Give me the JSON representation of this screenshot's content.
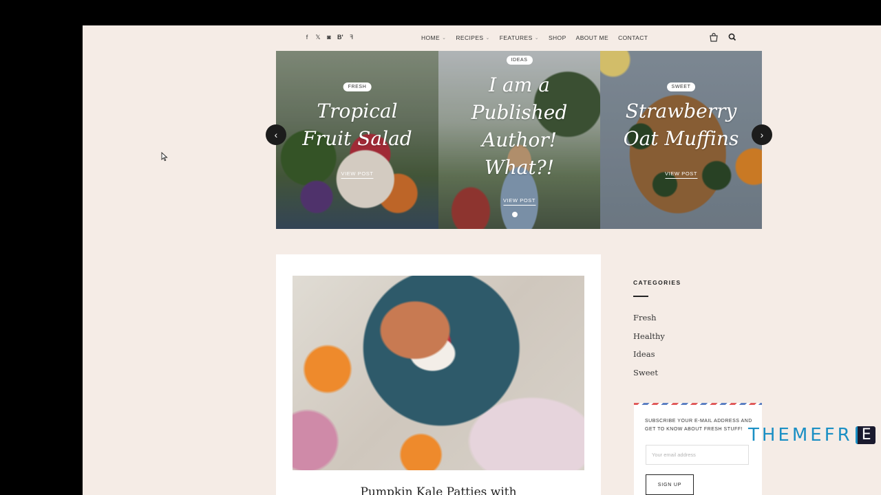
{
  "header": {
    "social_icons": [
      "facebook-icon",
      "twitter-icon",
      "instagram-icon",
      "bloglovin-icon",
      "foursquare-icon"
    ],
    "social_glyphs": [
      "f",
      "𝕏",
      "◙",
      "B'",
      "ꟻ"
    ],
    "nav": [
      {
        "label": "HOME",
        "dropdown": true
      },
      {
        "label": "RECIPES",
        "dropdown": true
      },
      {
        "label": "FEATURES",
        "dropdown": true
      },
      {
        "label": "SHOP",
        "dropdown": false
      },
      {
        "label": "ABOUT ME",
        "dropdown": false
      },
      {
        "label": "CONTACT",
        "dropdown": false
      }
    ],
    "right_icons": [
      "cart-icon",
      "search-icon"
    ]
  },
  "slider": {
    "slides": [
      {
        "tag": "FRESH",
        "title_lines": [
          "Tropical",
          "Fruit Salad"
        ],
        "link": "VIEW POST"
      },
      {
        "tag": "IDEAS",
        "title_lines": [
          "I am a",
          "Published",
          "Author!",
          "What?!"
        ],
        "link": "VIEW POST"
      },
      {
        "tag": "SWEET",
        "title_lines": [
          "Strawberry",
          "Oat Muffins"
        ],
        "link": "VIEW POST"
      }
    ],
    "prev_icon": "‹",
    "next_icon": "›",
    "active_dot": 0
  },
  "post": {
    "title": "Pumpkin Kale Patties with"
  },
  "sidebar": {
    "categories_heading": "CATEGORIES",
    "categories": [
      "Fresh",
      "Healthy",
      "Ideas",
      "Sweet"
    ],
    "subscribe": {
      "text": "SUBSCRIBE YOUR E-MAIL ADDRESS AND GET TO KNOW ABOUT FRESH STUFF!",
      "placeholder": "Your email address",
      "button": "SIGN UP"
    }
  },
  "watermark": {
    "text": "THEMEFR",
    "letter": "E"
  },
  "colors": {
    "page_bg": "#f5ece6",
    "watermark": "#1a8fc4"
  }
}
